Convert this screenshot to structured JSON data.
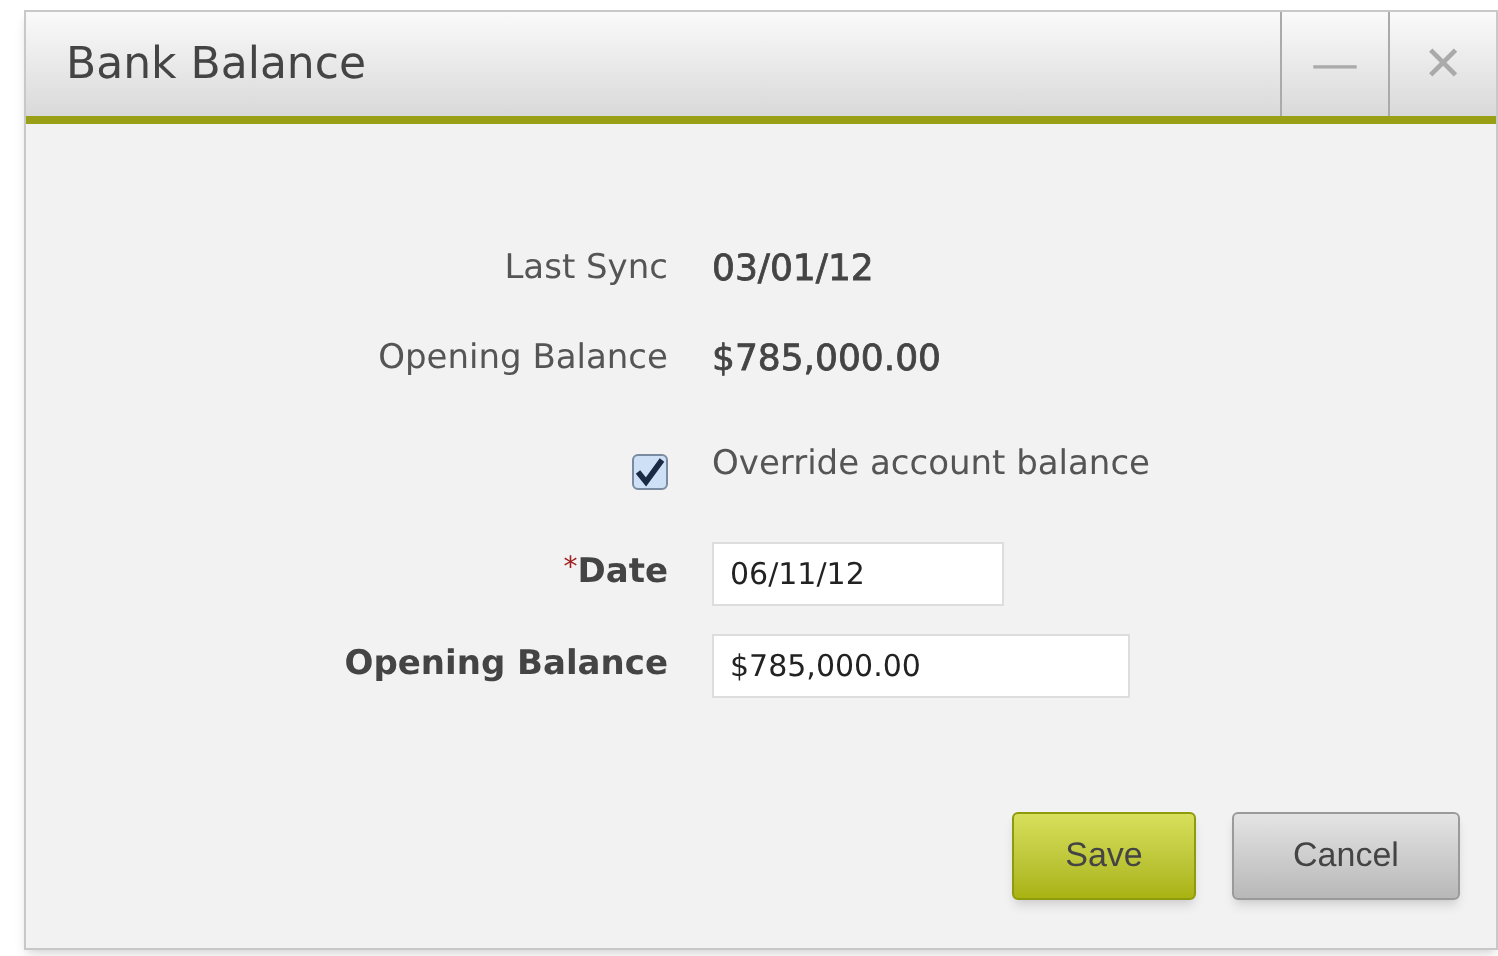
{
  "window": {
    "title": "Bank Balance",
    "controls": [
      "—",
      "✕"
    ]
  },
  "info": [
    {
      "label": "Last Sync",
      "value": "03/01/12"
    },
    {
      "label": "Opening Balance",
      "value": "$785,000.00"
    }
  ],
  "override": {
    "label": "Override account balance",
    "checked": true
  },
  "fields": [
    {
      "required_mark": "*",
      "label": "Date",
      "value": "06/11/12",
      "kind": "date"
    },
    {
      "label": "Opening Balance",
      "value": "$785,000.00",
      "kind": "amount"
    }
  ],
  "buttons": [
    {
      "label": "Save",
      "kind": "primary"
    },
    {
      "label": "Cancel",
      "kind": "secondary"
    }
  ]
}
